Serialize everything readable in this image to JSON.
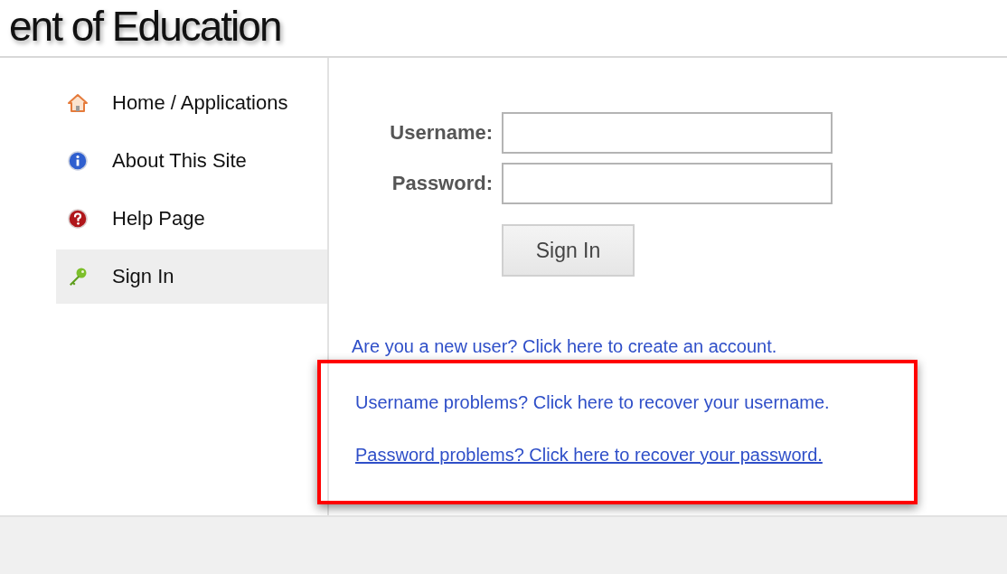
{
  "header": {
    "title": "ent of Education"
  },
  "sidebar": {
    "items": [
      {
        "label": "Home / Applications",
        "kind": "home",
        "selected": false
      },
      {
        "label": "About This Site",
        "kind": "info",
        "selected": false
      },
      {
        "label": "Help Page",
        "kind": "help",
        "selected": false
      },
      {
        "label": "Sign In",
        "kind": "key",
        "selected": true
      }
    ]
  },
  "form": {
    "fields": [
      {
        "label": "Username:"
      },
      {
        "label": "Password:"
      }
    ],
    "submit": "Sign In"
  },
  "link_groups": [
    {
      "highlighted": false,
      "links": [
        {
          "text": "Are you a new user? Click here to create an account.",
          "hovered": false
        }
      ]
    },
    {
      "highlighted": true,
      "links": [
        {
          "text": "Username problems? Click here to recover your username.",
          "hovered": false
        },
        {
          "text": "Password problems? Click here to recover your password.",
          "hovered": true
        }
      ]
    }
  ]
}
